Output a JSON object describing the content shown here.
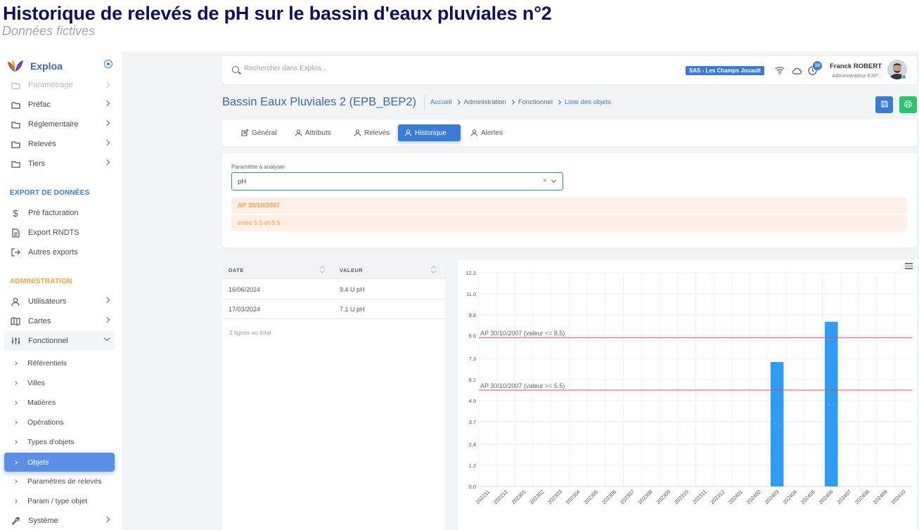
{
  "banner": {
    "title": "Historique de relevés de pH sur le bassin d'eaux pluviales n°2",
    "subtitle": "Données fictives"
  },
  "sidebar": {
    "brand": "Exploa",
    "top_items": [
      {
        "label": "Paramétrage",
        "icon": "folder-icon"
      },
      {
        "label": "Préfac",
        "icon": "folder-icon"
      },
      {
        "label": "Réglementaire",
        "icon": "folder-icon"
      },
      {
        "label": "Relevés",
        "icon": "folder-icon"
      },
      {
        "label": "Tiers",
        "icon": "folder-icon"
      }
    ],
    "export_title": "EXPORT DE DONNÉES",
    "export_items": [
      {
        "label": "Pré facturation",
        "icon": "dollar-icon"
      },
      {
        "label": "Export RNDTS",
        "icon": "file-icon"
      },
      {
        "label": "Autres exports",
        "icon": "logout-icon"
      }
    ],
    "admin_title": "ADMINISTRATION",
    "admin_items": [
      {
        "label": "Utilisateurs",
        "icon": "user-icon"
      },
      {
        "label": "Cartes",
        "icon": "map-icon"
      },
      {
        "label": "Fonctionnel",
        "icon": "sliders-icon"
      }
    ],
    "sub_items": [
      "Référentiels",
      "Villes",
      "Matières",
      "Opérations",
      "Types d'objets",
      "Objets",
      "Paramètres de relevés",
      "Param / type objet"
    ],
    "system_item": {
      "label": "Système",
      "icon": "wrench-icon"
    },
    "colors": {
      "export_title": "#3a7bd5",
      "admin_title": "#ff9f43",
      "active": "#5b8ee6"
    }
  },
  "topbar": {
    "search_placeholder": "Rechercher dans Exploa...",
    "site_badge": "SAS - Les Champs Jouault",
    "notification_count": "10",
    "user_name": "Franck ROBERT",
    "user_role": "Administrateur EXP..."
  },
  "page": {
    "title": "Bassin Eaux Pluviales 2 (EPB_BEP2)",
    "breadcrumb": [
      "Accueil",
      "Administration",
      "Fonctionnel",
      "Liste des objets"
    ]
  },
  "tabs": [
    {
      "label": "Général",
      "icon": "edit-icon"
    },
    {
      "label": "Attributs",
      "icon": "user-icon"
    },
    {
      "label": "Relevés",
      "icon": "user-icon"
    },
    {
      "label": "Historique",
      "icon": "user-icon",
      "active": true
    },
    {
      "label": "Alertes",
      "icon": "user-icon"
    }
  ],
  "parameter": {
    "label": "Paramètre à analyser",
    "value": "pH",
    "clear": "×",
    "alerts": [
      "AP 30/10/2007",
      "entre 5.5 et 8.5"
    ]
  },
  "table": {
    "columns": [
      "DATE",
      "VALEUR"
    ],
    "rows": [
      {
        "date": "16/06/2024",
        "value": "9.4 U pH"
      },
      {
        "date": "17/03/2024",
        "value": "7.1 U pH"
      }
    ],
    "total": "2 lignes au total"
  },
  "chart_data": {
    "type": "bar",
    "categories": [
      "202211",
      "202212",
      "202301",
      "202302",
      "202303",
      "202304",
      "202305",
      "202306",
      "202307",
      "202308",
      "202309",
      "202310",
      "202311",
      "202312",
      "202401",
      "202402",
      "202403",
      "202404",
      "202405",
      "202406",
      "202407",
      "202408",
      "202409",
      "202410"
    ],
    "values": [
      null,
      null,
      null,
      null,
      null,
      null,
      null,
      null,
      null,
      null,
      null,
      null,
      null,
      null,
      null,
      null,
      7.1,
      null,
      null,
      9.4,
      null,
      null,
      null,
      null
    ],
    "data_labels": {
      "16": "7.1",
      "19": "9.4"
    },
    "y_ticks": [
      "0.0",
      "1.2",
      "2.4",
      "3.7",
      "4.9",
      "6.1",
      "7.3",
      "8.6",
      "9.8",
      "11.0",
      "12.2"
    ],
    "ylim": [
      0,
      12.2
    ],
    "grid": true,
    "bar_color": "#2e9bf5",
    "thresholds": [
      {
        "label": "AP 30/10/2007 (valeur <= 8.5)",
        "value": 8.5,
        "color": "#e05050"
      },
      {
        "label": "AP 30/10/2007 (valeur >= 5.5)",
        "value": 5.5,
        "color": "#e05050"
      }
    ]
  }
}
